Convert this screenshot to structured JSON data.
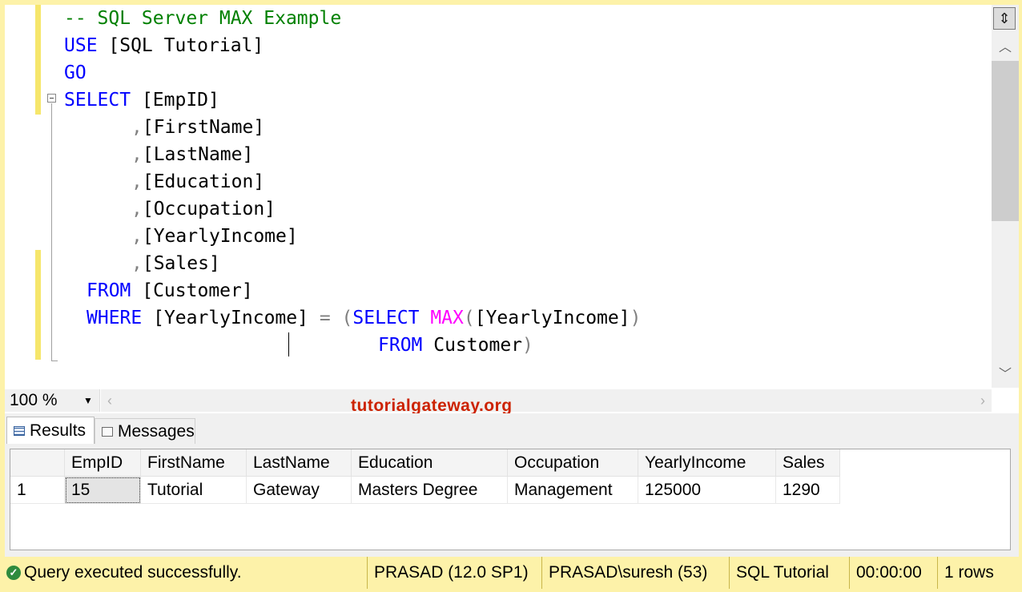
{
  "editor": {
    "lines": [
      {
        "comment": "-- SQL Server MAX Example"
      },
      {
        "kw": "USE",
        "rest": " [SQL Tutorial]"
      },
      {
        "kw": "GO"
      },
      {
        "kw": "SELECT",
        "rest": " [EmpID]"
      },
      {
        "comma": ",",
        "rest": "[FirstName]"
      },
      {
        "comma": ",",
        "rest": "[LastName]"
      },
      {
        "comma": ",",
        "rest": "[Education]"
      },
      {
        "comma": ",",
        "rest": "[Occupation]"
      },
      {
        "comma": ",",
        "rest": "[YearlyIncome]"
      },
      {
        "comma": ",",
        "rest": "[Sales]"
      },
      {
        "kw": "FROM",
        "rest": " [Customer]"
      },
      {
        "kw": "WHERE",
        "rest": " [YearlyIncome] ",
        "op": "=",
        "paren_open": " (",
        "kw2": "SELECT",
        "fn": " MAX",
        "paren2": "(",
        "arg": "[YearlyIncome]",
        "paren_close": ")"
      },
      {
        "kw": "FROM",
        "rest": " Customer",
        "paren_close": ")"
      }
    ]
  },
  "zoom": {
    "value": "100 %"
  },
  "watermark": "tutorialgateway.org",
  "tabs": [
    {
      "label": "Results",
      "icon": "grid-icon",
      "active": true
    },
    {
      "label": "Messages",
      "icon": "messages-icon",
      "active": false
    }
  ],
  "results": {
    "columns": [
      "",
      "EmpID",
      "FirstName",
      "LastName",
      "Education",
      "Occupation",
      "YearlyIncome",
      "Sales"
    ],
    "rows": [
      [
        "1",
        "15",
        "Tutorial",
        "Gateway",
        "Masters Degree",
        "Management",
        "125000",
        "1290"
      ]
    ]
  },
  "status": {
    "message": "Query executed successfully.",
    "server": "PRASAD (12.0 SP1)",
    "user": "PRASAD\\suresh (53)",
    "database": "SQL Tutorial",
    "elapsed": "00:00:00",
    "rows": "1 rows"
  },
  "colors": {
    "keyword": "#0000ff",
    "comment": "#008000",
    "function": "#ff00ff",
    "statusbar": "#fdf2a9",
    "watermark": "#cc2200"
  }
}
